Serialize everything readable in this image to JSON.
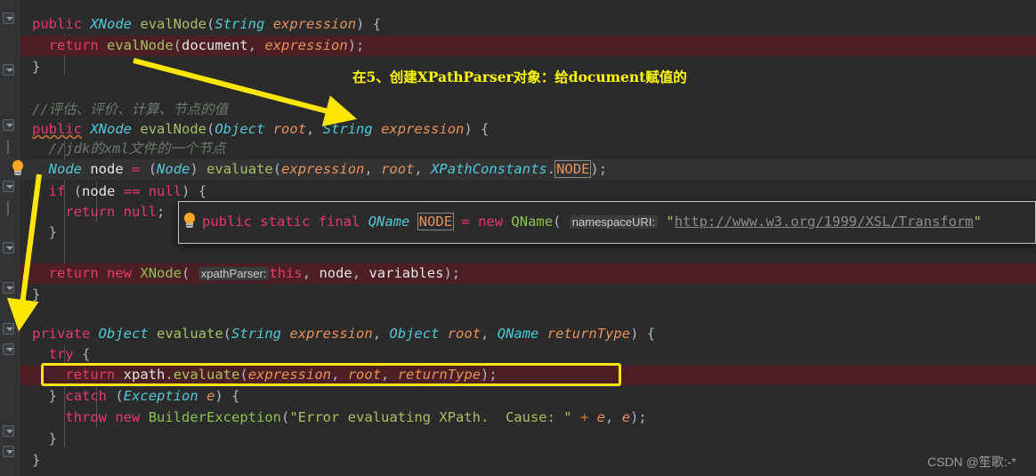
{
  "editor": {
    "background": "#2b2b2b",
    "gutter_background": "#313335",
    "highlight_color": "#4b1f23",
    "code_lines": [
      {
        "indent": 0,
        "text": "public XNode evalNode(String expression) {"
      },
      {
        "indent": 1,
        "text": "return evalNode(document, expression);"
      },
      {
        "indent": 0,
        "text": "}"
      },
      {
        "indent": 0,
        "text": ""
      },
      {
        "indent": 0,
        "text": "//评估、评价、计算、节点的值"
      },
      {
        "indent": 0,
        "text": "public XNode evalNode(Object root, String expression) {"
      },
      {
        "indent": 1,
        "text": "//jdk的xml文件的一个节点"
      },
      {
        "indent": 1,
        "text": "Node node = (Node) evaluate(expression, root, XPathConstants.NODE);"
      },
      {
        "indent": 1,
        "text": "if (node == null) {"
      },
      {
        "indent": 2,
        "text": "return null;"
      },
      {
        "indent": 1,
        "text": "}"
      },
      {
        "indent": 1,
        "text": "return new XNode( xpathParser: this, node, variables);"
      },
      {
        "indent": 0,
        "text": "}"
      },
      {
        "indent": 0,
        "text": ""
      },
      {
        "indent": 0,
        "text": "private Object evaluate(String expression, Object root, QName returnType) {"
      },
      {
        "indent": 1,
        "text": "try {"
      },
      {
        "indent": 2,
        "text": "return xpath.evaluate(expression, root, returnType);"
      },
      {
        "indent": 1,
        "text": "} catch (Exception e) {"
      },
      {
        "indent": 2,
        "text": "throw new BuilderException(\"Error evaluating XPath.  Cause: \" + e, e);"
      },
      {
        "indent": 1,
        "text": "}"
      },
      {
        "indent": 0,
        "text": "}"
      }
    ],
    "parameter_hints": [
      "xpathParser:",
      "namespaceURI:"
    ],
    "highlighted_token": "NODE"
  },
  "popup": {
    "signature": "public static final QName NODE = new QName( namespaceURI: \"http://www.w3.org/1999/XSL/Transform\"",
    "keyword_public": "public",
    "keyword_static": "static",
    "keyword_final": "final",
    "type_qname": "QName",
    "field_name": "NODE",
    "assign": "=",
    "keyword_new": "new",
    "ctor": "QName",
    "param_hint": "namespaceURI:",
    "url_literal": "\"http://www.w3.org/1999/XSL/Transform\"",
    "bulb_icon": "lightbulb-icon"
  },
  "annotations": {
    "note_text": "在5、创建XPathParser对象：给document赋值的",
    "note_color": "#ffff00",
    "box_color": "#ffe600",
    "boxed_code": "return xpath.evaluate(expression, root, returnType);",
    "arrow_1_label": "arrow-to-evalnode-overload",
    "arrow_2_label": "arrow-to-evaluate-method"
  },
  "watermark": {
    "text": "CSDN @笙歌:-*"
  }
}
